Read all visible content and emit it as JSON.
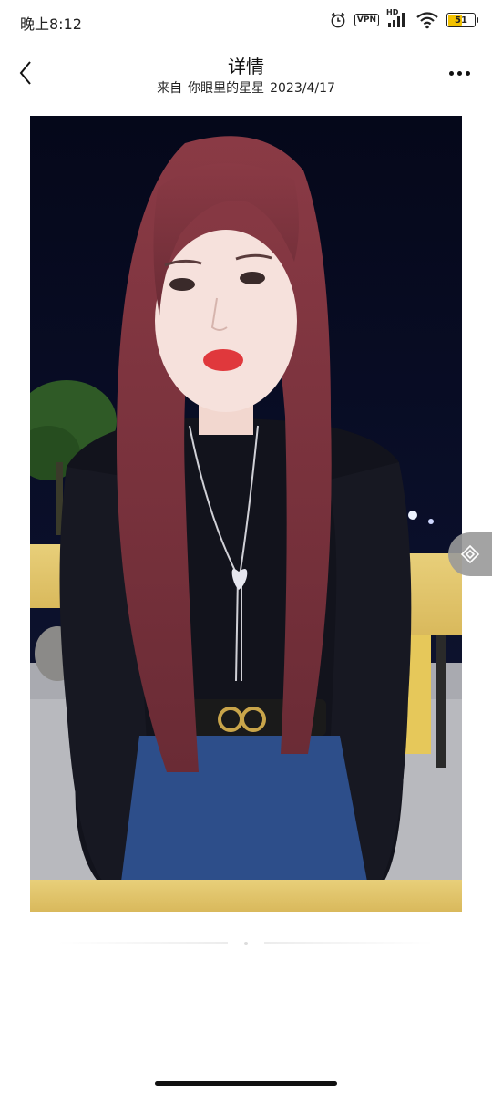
{
  "status_bar": {
    "time": "晚上8:12",
    "vpn": "VPN",
    "network": "HD",
    "battery": "51",
    "battery_level": 0.51
  },
  "header": {
    "title": "详情",
    "source_prefix": "来自",
    "source_name": "你眼里的星星",
    "date": "2023/4/17",
    "back_icon": "chevron-left-icon",
    "more_icon": "more-horizontal-icon"
  },
  "content": {
    "photo_icon": "photo",
    "side_button_icon": "diamond-toggle-icon"
  },
  "colors": {
    "background": "#ffffff",
    "text": "#111111",
    "side_button": "#9a9a9a"
  }
}
